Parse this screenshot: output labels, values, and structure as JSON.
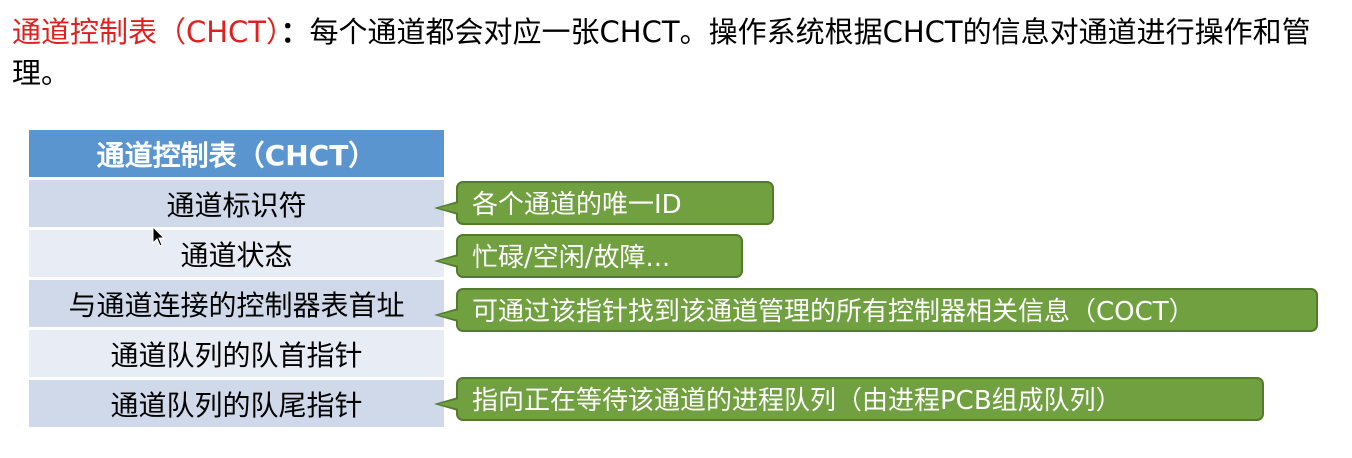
{
  "intro": {
    "term": "通道控制表（CHCT）",
    "colon": "：",
    "body": "每个通道都会对应一张CHCT。操作系统根据CHCT的信息对通道进行操作和管理。"
  },
  "table": {
    "header": "通道控制表（CHCT）",
    "rows": [
      "通道标识符",
      "通道状态",
      "与通道连接的控制器表首址",
      "通道队列的队首指针",
      "通道队列的队尾指针"
    ]
  },
  "callouts": [
    "各个通道的唯一ID",
    "忙碌/空闲/故障...",
    "可通过该指针找到该通道管理的所有控制器相关信息（COCT）",
    "指向正在等待该通道的进程队列（由进程PCB组成队列）"
  ],
  "colors": {
    "term": "#e02020",
    "header_bg": "#5b95cf",
    "row_dark": "#cfd9ea",
    "row_light": "#e8edf5",
    "callout_bg": "#70a03f",
    "callout_border": "#547a2c"
  }
}
